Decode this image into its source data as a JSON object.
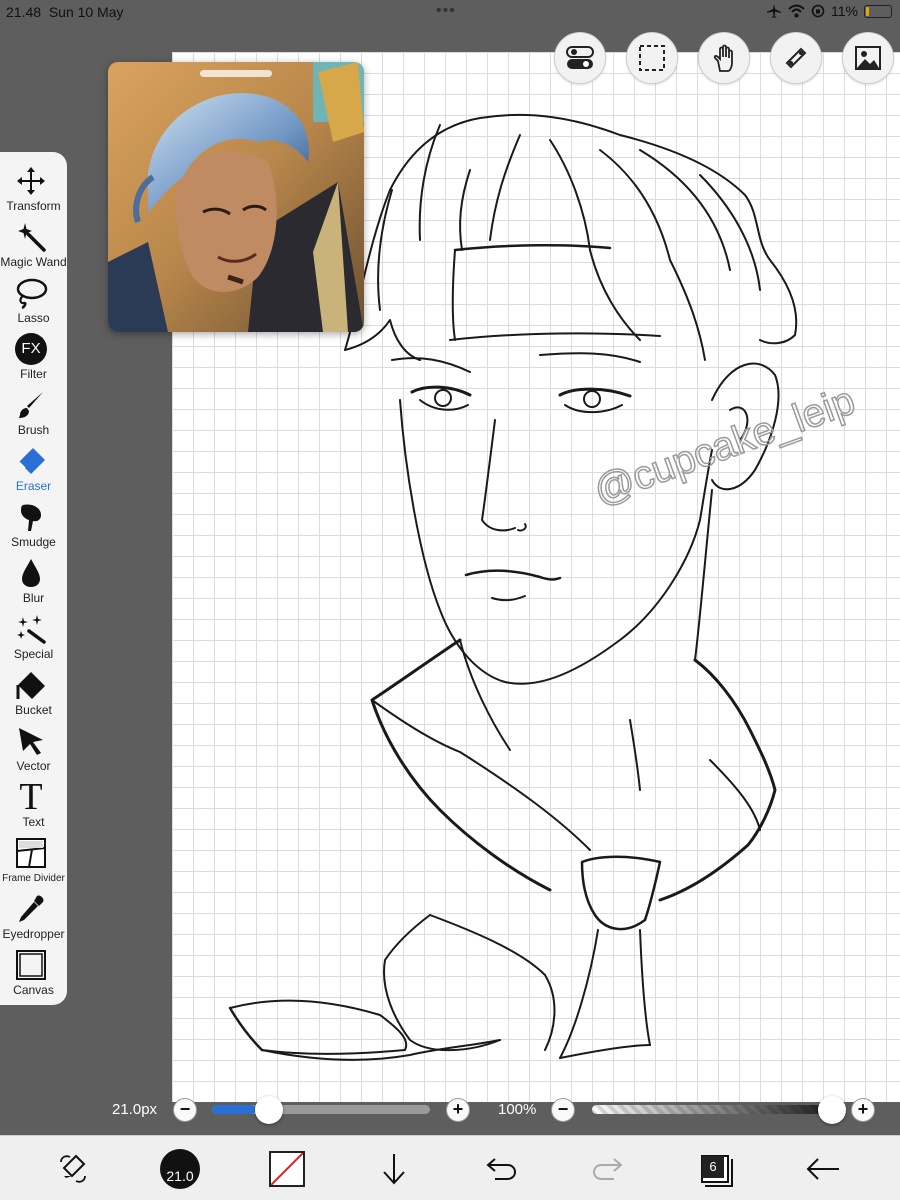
{
  "status_bar": {
    "time": "21.48",
    "date": "Sun 10 May",
    "battery_percent": "11%",
    "battery_level": 0.11,
    "multitask_dots": "•••",
    "icons": [
      "airplane-icon",
      "wifi-icon",
      "orientation-lock-icon",
      "battery-icon"
    ]
  },
  "top_buttons": [
    {
      "name": "toggle-icon"
    },
    {
      "name": "selection-icon"
    },
    {
      "name": "hand-icon"
    },
    {
      "name": "ruler-icon"
    },
    {
      "name": "material-icon"
    }
  ],
  "tools": [
    {
      "label": "Transform",
      "icon": "move-arrows-icon"
    },
    {
      "label": "Magic Wand",
      "icon": "magic-wand-icon"
    },
    {
      "label": "Lasso",
      "icon": "lasso-icon"
    },
    {
      "label": "Filter",
      "icon": "fx-icon",
      "glyph": "FX"
    },
    {
      "label": "Brush",
      "icon": "brush-icon"
    },
    {
      "label": "Eraser",
      "icon": "eraser-icon",
      "active": true
    },
    {
      "label": "Smudge",
      "icon": "smudge-icon"
    },
    {
      "label": "Blur",
      "icon": "drop-icon"
    },
    {
      "label": "Special",
      "icon": "sparkle-icon"
    },
    {
      "label": "Bucket",
      "icon": "bucket-icon"
    },
    {
      "label": "Vector",
      "icon": "cursor-arrow-icon"
    },
    {
      "label": "Text",
      "icon": "text-icon",
      "glyph": "T"
    },
    {
      "label": "Frame Divider",
      "icon": "frame-divider-icon"
    },
    {
      "label": "Eyedropper",
      "icon": "eyedropper-icon"
    },
    {
      "label": "Canvas",
      "icon": "canvas-icon"
    }
  ],
  "brush_size": {
    "value_label": "21.0px",
    "minus": "−",
    "plus": "+",
    "level": 0.2
  },
  "opacity": {
    "value_label": "100%",
    "minus": "−",
    "plus": "+",
    "level": 1.0
  },
  "bottom_bar": {
    "brush_size_label": "21.0",
    "layers_count": "6",
    "primary_color": "#ffffff",
    "icons": [
      "swap-tools-icon",
      "brush-size-icon",
      "color-swatch-icon",
      "download-arrow-icon",
      "undo-icon",
      "redo-icon",
      "layers-icon",
      "back-arrow-icon"
    ]
  },
  "watermark": "@cupcake_leip",
  "colors": {
    "accent": "#2a6fd6",
    "toolbar_bg": "#f4f4f4",
    "frame_bg": "#5e5e5e"
  }
}
